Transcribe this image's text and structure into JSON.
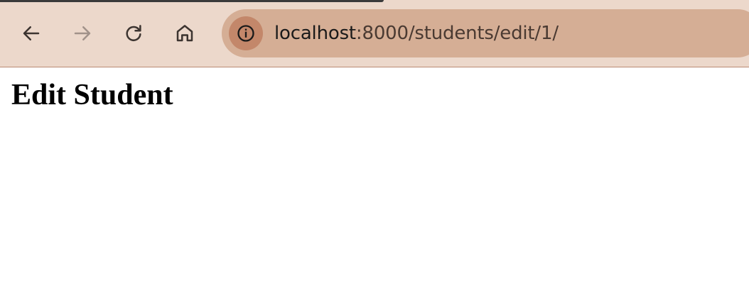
{
  "browser": {
    "url_host": "localhost",
    "url_rest": ":8000/students/edit/1/",
    "icons": {
      "back": "back-arrow-icon",
      "forward": "forward-arrow-icon",
      "reload": "reload-icon",
      "home": "home-icon",
      "site_info": "info-icon"
    },
    "colors": {
      "toolbar": "#ecd8cb",
      "omnibox": "#d5ae95",
      "site_info_bg": "#c3876a"
    }
  },
  "page": {
    "heading": "Edit Student"
  }
}
